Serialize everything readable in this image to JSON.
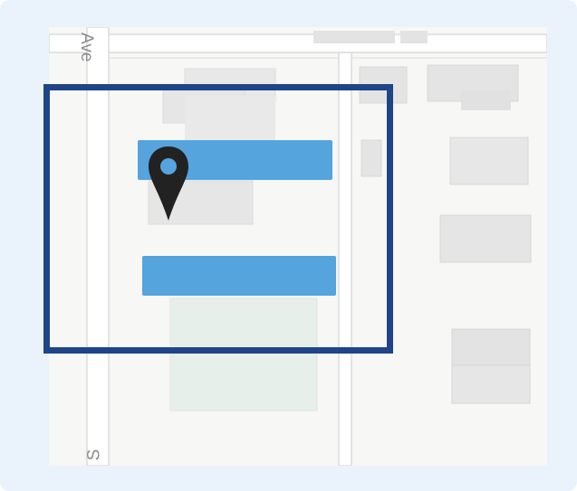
{
  "map": {
    "street_label_top": "Ave",
    "street_label_bottom": "S",
    "highlight_color": "#55a4dd",
    "selection_color": "#1f4488",
    "pin_color": "#222222",
    "pin_dot_color": "#55a4dd",
    "icon": "map-pin-icon"
  }
}
